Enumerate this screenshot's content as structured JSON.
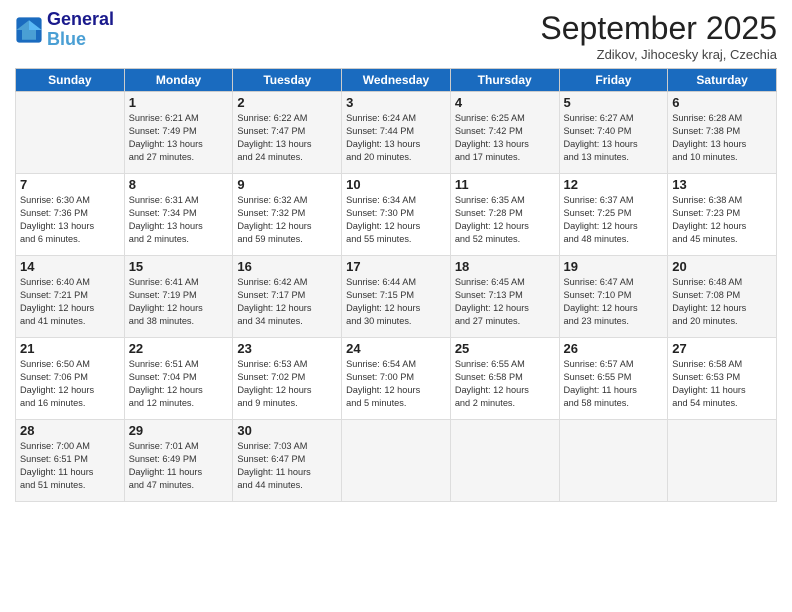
{
  "logo": {
    "line1": "General",
    "line2": "Blue"
  },
  "title": "September 2025",
  "subtitle": "Zdikov, Jihocesky kraj, Czechia",
  "days_of_week": [
    "Sunday",
    "Monday",
    "Tuesday",
    "Wednesday",
    "Thursday",
    "Friday",
    "Saturday"
  ],
  "weeks": [
    [
      {
        "day": "",
        "info": ""
      },
      {
        "day": "1",
        "info": "Sunrise: 6:21 AM\nSunset: 7:49 PM\nDaylight: 13 hours\nand 27 minutes."
      },
      {
        "day": "2",
        "info": "Sunrise: 6:22 AM\nSunset: 7:47 PM\nDaylight: 13 hours\nand 24 minutes."
      },
      {
        "day": "3",
        "info": "Sunrise: 6:24 AM\nSunset: 7:44 PM\nDaylight: 13 hours\nand 20 minutes."
      },
      {
        "day": "4",
        "info": "Sunrise: 6:25 AM\nSunset: 7:42 PM\nDaylight: 13 hours\nand 17 minutes."
      },
      {
        "day": "5",
        "info": "Sunrise: 6:27 AM\nSunset: 7:40 PM\nDaylight: 13 hours\nand 13 minutes."
      },
      {
        "day": "6",
        "info": "Sunrise: 6:28 AM\nSunset: 7:38 PM\nDaylight: 13 hours\nand 10 minutes."
      }
    ],
    [
      {
        "day": "7",
        "info": "Sunrise: 6:30 AM\nSunset: 7:36 PM\nDaylight: 13 hours\nand 6 minutes."
      },
      {
        "day": "8",
        "info": "Sunrise: 6:31 AM\nSunset: 7:34 PM\nDaylight: 13 hours\nand 2 minutes."
      },
      {
        "day": "9",
        "info": "Sunrise: 6:32 AM\nSunset: 7:32 PM\nDaylight: 12 hours\nand 59 minutes."
      },
      {
        "day": "10",
        "info": "Sunrise: 6:34 AM\nSunset: 7:30 PM\nDaylight: 12 hours\nand 55 minutes."
      },
      {
        "day": "11",
        "info": "Sunrise: 6:35 AM\nSunset: 7:28 PM\nDaylight: 12 hours\nand 52 minutes."
      },
      {
        "day": "12",
        "info": "Sunrise: 6:37 AM\nSunset: 7:25 PM\nDaylight: 12 hours\nand 48 minutes."
      },
      {
        "day": "13",
        "info": "Sunrise: 6:38 AM\nSunset: 7:23 PM\nDaylight: 12 hours\nand 45 minutes."
      }
    ],
    [
      {
        "day": "14",
        "info": "Sunrise: 6:40 AM\nSunset: 7:21 PM\nDaylight: 12 hours\nand 41 minutes."
      },
      {
        "day": "15",
        "info": "Sunrise: 6:41 AM\nSunset: 7:19 PM\nDaylight: 12 hours\nand 38 minutes."
      },
      {
        "day": "16",
        "info": "Sunrise: 6:42 AM\nSunset: 7:17 PM\nDaylight: 12 hours\nand 34 minutes."
      },
      {
        "day": "17",
        "info": "Sunrise: 6:44 AM\nSunset: 7:15 PM\nDaylight: 12 hours\nand 30 minutes."
      },
      {
        "day": "18",
        "info": "Sunrise: 6:45 AM\nSunset: 7:13 PM\nDaylight: 12 hours\nand 27 minutes."
      },
      {
        "day": "19",
        "info": "Sunrise: 6:47 AM\nSunset: 7:10 PM\nDaylight: 12 hours\nand 23 minutes."
      },
      {
        "day": "20",
        "info": "Sunrise: 6:48 AM\nSunset: 7:08 PM\nDaylight: 12 hours\nand 20 minutes."
      }
    ],
    [
      {
        "day": "21",
        "info": "Sunrise: 6:50 AM\nSunset: 7:06 PM\nDaylight: 12 hours\nand 16 minutes."
      },
      {
        "day": "22",
        "info": "Sunrise: 6:51 AM\nSunset: 7:04 PM\nDaylight: 12 hours\nand 12 minutes."
      },
      {
        "day": "23",
        "info": "Sunrise: 6:53 AM\nSunset: 7:02 PM\nDaylight: 12 hours\nand 9 minutes."
      },
      {
        "day": "24",
        "info": "Sunrise: 6:54 AM\nSunset: 7:00 PM\nDaylight: 12 hours\nand 5 minutes."
      },
      {
        "day": "25",
        "info": "Sunrise: 6:55 AM\nSunset: 6:58 PM\nDaylight: 12 hours\nand 2 minutes."
      },
      {
        "day": "26",
        "info": "Sunrise: 6:57 AM\nSunset: 6:55 PM\nDaylight: 11 hours\nand 58 minutes."
      },
      {
        "day": "27",
        "info": "Sunrise: 6:58 AM\nSunset: 6:53 PM\nDaylight: 11 hours\nand 54 minutes."
      }
    ],
    [
      {
        "day": "28",
        "info": "Sunrise: 7:00 AM\nSunset: 6:51 PM\nDaylight: 11 hours\nand 51 minutes."
      },
      {
        "day": "29",
        "info": "Sunrise: 7:01 AM\nSunset: 6:49 PM\nDaylight: 11 hours\nand 47 minutes."
      },
      {
        "day": "30",
        "info": "Sunrise: 7:03 AM\nSunset: 6:47 PM\nDaylight: 11 hours\nand 44 minutes."
      },
      {
        "day": "",
        "info": ""
      },
      {
        "day": "",
        "info": ""
      },
      {
        "day": "",
        "info": ""
      },
      {
        "day": "",
        "info": ""
      }
    ]
  ]
}
